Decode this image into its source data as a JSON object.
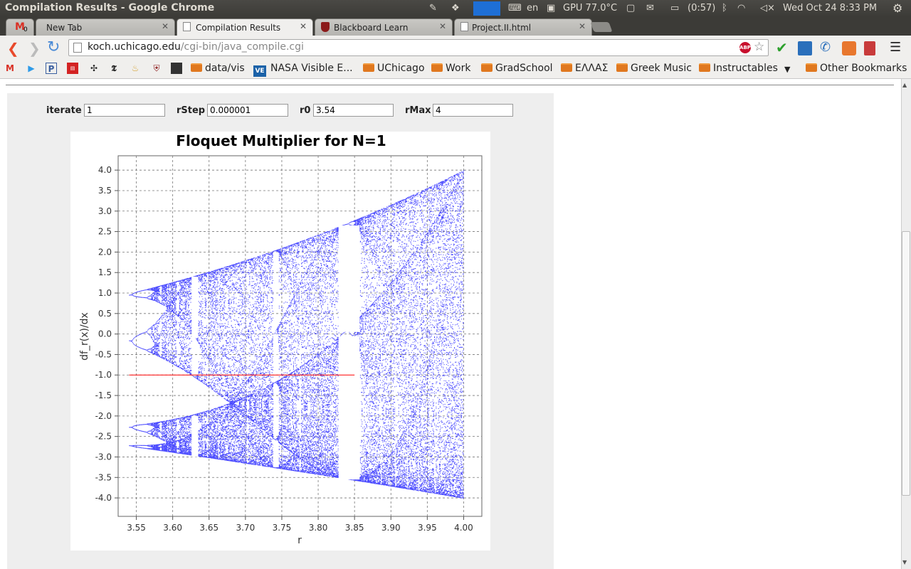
{
  "os_panel": {
    "window_title": "Compilation Results - Google Chrome",
    "keyboard": "en",
    "gpu_temp": "GPU 77.0°C",
    "battery": "(0:57)",
    "datetime": "Wed Oct 24   8:33 PM"
  },
  "tabs": [
    {
      "label": "New Tab",
      "active": false
    },
    {
      "label": "Compilation Results",
      "active": true
    },
    {
      "label": "Blackboard Learn",
      "active": false
    },
    {
      "label": "Project.II.html",
      "active": false
    }
  ],
  "gmail_count": "0",
  "address_bar": {
    "host": "koch.uchicago.edu",
    "path": "/cgi-bin/java_compile.cgi"
  },
  "bookmarks": {
    "items": [
      {
        "label": "data/vis",
        "folder": true
      },
      {
        "label": "NASA Visible E...",
        "folder": false
      },
      {
        "label": "UChicago",
        "folder": true
      },
      {
        "label": "Work",
        "folder": true
      },
      {
        "label": "GradSchool",
        "folder": true
      },
      {
        "label": "ΕΛΛΑΣ",
        "folder": true
      },
      {
        "label": "Greek Music",
        "folder": true
      },
      {
        "label": "Instructables",
        "folder": true
      }
    ],
    "other": "Other Bookmarks"
  },
  "form": {
    "iterate_label": "iterate",
    "iterate_value": "1",
    "rstep_label": "rStep",
    "rstep_value": "0.000001",
    "r0_label": "r0",
    "r0_value": "3.54",
    "rmax_label": "rMax",
    "rmax_value": "4"
  },
  "colors": {
    "points": "#4d4dff",
    "reference_line": "#ff0000"
  },
  "chart_data": {
    "type": "scatter",
    "title": "Floquet Multiplier for N=1",
    "xlabel": "r",
    "ylabel": "df_r(x)/dx",
    "xlim": [
      3.525,
      4.025
    ],
    "ylim": [
      -4.45,
      4.35
    ],
    "x_ticks": [
      3.55,
      3.6,
      3.65,
      3.7,
      3.75,
      3.8,
      3.85,
      3.9,
      3.95,
      4.0
    ],
    "y_ticks": [
      4.0,
      3.5,
      3.0,
      2.5,
      2.0,
      1.5,
      1.0,
      0.5,
      0.0,
      -0.5,
      -1.0,
      -1.5,
      -2.0,
      -2.5,
      -3.0,
      -3.5,
      -4.0
    ],
    "x_tick_labels": [
      "3.55",
      "3.60",
      "3.65",
      "3.70",
      "3.75",
      "3.80",
      "3.85",
      "3.90",
      "3.95",
      "4.00"
    ],
    "y_tick_labels": [
      "4.0",
      "3.5",
      "3.0",
      "2.5",
      "2.0",
      "1.5",
      "1.0",
      "0.5",
      "0.0",
      "-0.5",
      "-1.0",
      "-1.5",
      "-2.0",
      "-2.5",
      "-3.0",
      "-3.5",
      "-4.0"
    ],
    "grid": true,
    "reference_line": {
      "y": -1.0,
      "x_start": 3.54,
      "x_end": 3.85
    },
    "envelope": {
      "upper": [
        [
          3.54,
          0.95
        ],
        [
          3.63,
          1.4
        ],
        [
          3.75,
          2.0
        ],
        [
          3.85,
          2.65
        ],
        [
          4.0,
          4.0
        ]
      ],
      "lower": [
        [
          3.54,
          -2.7
        ],
        [
          3.63,
          -3.0
        ],
        [
          3.75,
          -3.25
        ],
        [
          3.85,
          -3.55
        ],
        [
          4.0,
          -4.0
        ]
      ]
    },
    "periodic_windows": [
      {
        "x_start": 3.626,
        "x_end": 3.635,
        "bands": [
          [
            1.4,
            -0.1
          ],
          [
            -0.6,
            -1.0
          ],
          [
            -2.0,
            -3.0
          ]
        ]
      },
      {
        "x_start": 3.738,
        "x_end": 3.745,
        "bands": [
          [
            2.0,
            1.6
          ],
          [
            0.0,
            -0.5
          ],
          [
            -2.6,
            -3.25
          ]
        ]
      },
      {
        "x_start": 3.828,
        "x_end": 3.857,
        "bands": [
          [
            2.65,
            0.05
          ],
          [
            -0.05,
            -3.55
          ]
        ]
      }
    ],
    "series": [
      {
        "values_description_samples": [
          [
            3.56,
            1.0
          ],
          [
            3.56,
            0.0
          ],
          [
            3.56,
            -2.3
          ],
          [
            3.56,
            -2.7
          ],
          [
            3.7,
            1.8
          ],
          [
            3.7,
            -1.9
          ],
          [
            3.9,
            3.0
          ],
          [
            3.9,
            -3.7
          ],
          [
            4.0,
            4.0
          ],
          [
            4.0,
            -4.0
          ]
        ]
      }
    ]
  }
}
